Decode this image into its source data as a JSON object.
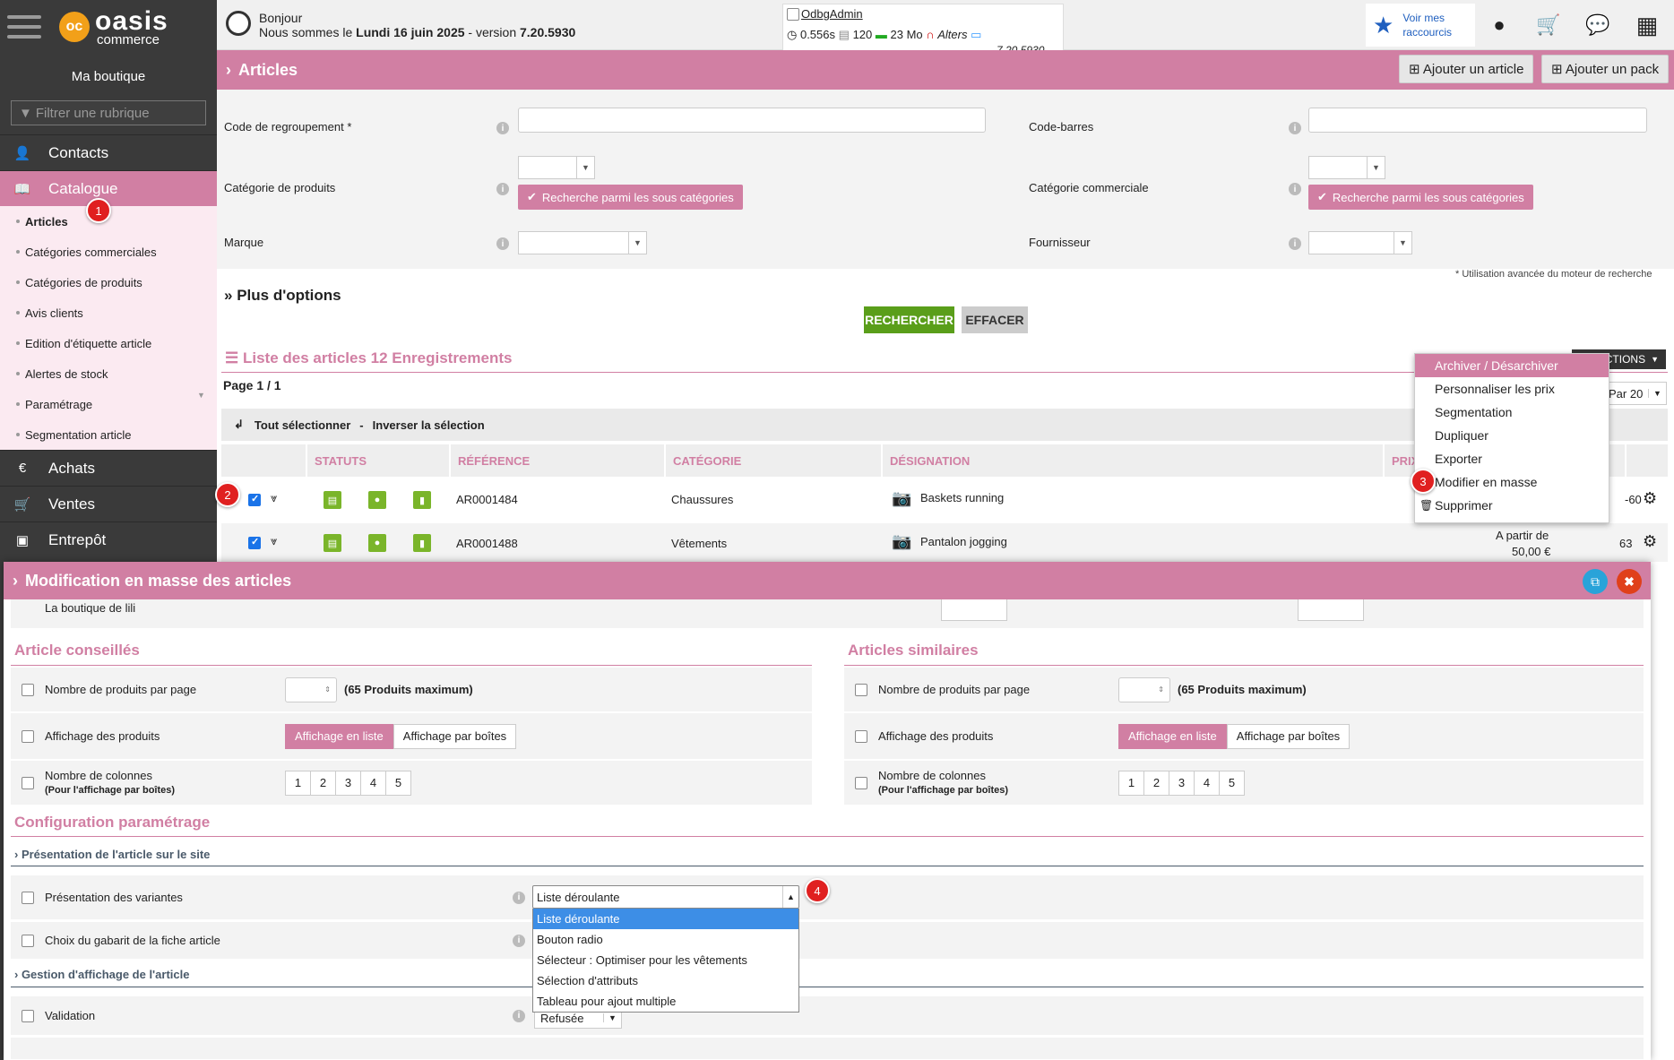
{
  "app": {
    "brand_logo": "oc",
    "brand_name": "oasis",
    "brand_sub": "commerce",
    "shop": "Ma boutique",
    "filter_placeholder": "Filtrer une rubrique"
  },
  "sidebar": {
    "contacts": "Contacts",
    "catalogue": "Catalogue",
    "sub": [
      "Articles",
      "Catégories commerciales",
      "Catégories de produits",
      "Avis clients",
      "Edition d'étiquette article",
      "Alertes de stock",
      "Paramétrage",
      "Segmentation article"
    ],
    "achats": "Achats",
    "ventes": "Ventes",
    "entrepot": "Entrepôt"
  },
  "header": {
    "greeting": "Bonjour",
    "date_prefix": "Nous sommes le",
    "date": "Lundi 16 juin 2025",
    "version_prefix": "- version",
    "version": "7.20.5930",
    "debug": {
      "user": "OdbgAdmin",
      "time": "0.556s",
      "count": "120",
      "mem": "23 Mo",
      "alters": "Alters",
      "version": "7.20.5930"
    },
    "shortcuts_line1": "Voir mes",
    "shortcuts_line2": "raccourcis"
  },
  "page": {
    "title": "Articles",
    "add_article": "Ajouter un article",
    "add_pack": "Ajouter un pack"
  },
  "form": {
    "code_regroupement": "Code de regroupement *",
    "code_barres": "Code-barres",
    "cat_produits": "Catégorie de produits",
    "cat_commerciale": "Catégorie commerciale",
    "recherche_sous": "Recherche parmi les sous catégories",
    "marque": "Marque",
    "fournisseur": "Fournisseur",
    "note": "* Utilisation avancée du moteur de recherche",
    "plus_options": "Plus d'options",
    "rechercher": "RECHERCHER",
    "effacer": "EFFACER"
  },
  "list": {
    "title": "Liste des articles 12 Enregistrements",
    "page": "Page 1 / 1",
    "actions": "CTIONS",
    "per_page": "Par 20",
    "select_all": "Tout sélectionner",
    "sep": "-",
    "invert": "Inverser la sélection",
    "columns": [
      "STATUTS",
      "RÉFÉRENCE",
      "CATÉGORIE",
      "DÉSIGNATION",
      "PRIX"
    ],
    "rows": [
      {
        "ref": "AR0001484",
        "cat": "Chaussures",
        "des": "Baskets running",
        "price_a": "",
        "price_b": "",
        "extra": "-60"
      },
      {
        "ref": "AR0001488",
        "cat": "Vêtements",
        "des": "Pantalon jogging",
        "price_a": "A partir de",
        "price_b": "50,00 €",
        "extra": "63"
      }
    ]
  },
  "actions_menu": [
    "Archiver / Désarchiver",
    "Personnaliser les prix",
    "Segmentation",
    "Dupliquer",
    "Exporter",
    "Modifier en masse",
    "Supprimer"
  ],
  "badges": [
    "1",
    "2",
    "3",
    "4"
  ],
  "modal": {
    "title": "Modification en masse des articles",
    "shop": "La boutique de lili",
    "left_title": "Article conseillés",
    "right_title": "Articles similaires",
    "nb_par_page": "Nombre de produits par page",
    "max": "(65 Produits maximum)",
    "affichage": "Affichage des produits",
    "aff_liste": "Affichage en liste",
    "aff_boites": "Affichage par boîtes",
    "nb_colonnes": "Nombre de colonnes",
    "nb_colonnes_sub": "(Pour l'affichage par boîtes)",
    "col_nums": [
      "1",
      "2",
      "3",
      "4",
      "5"
    ],
    "config": "Configuration paramétrage",
    "pres_site": "› Présentation de l'article sur le site",
    "pres_variantes": "Présentation des variantes",
    "gabarit": "Choix du gabarit de la fiche article",
    "gestion": "› Gestion d'affichage de l'article",
    "validation": "Validation",
    "validation_val": "Refusée",
    "dropdown_value": "Liste déroulante",
    "dropdown_options": [
      "Liste déroulante",
      "Bouton radio",
      "Sélecteur : Optimiser pour les vêtements",
      "Sélection d'attributs",
      "Tableau pour ajout multiple"
    ]
  },
  "colors": {
    "accent": "#d17fa3",
    "sidebar": "#3a3a3a",
    "green": "#7ab52a",
    "badge": "#e02020"
  }
}
